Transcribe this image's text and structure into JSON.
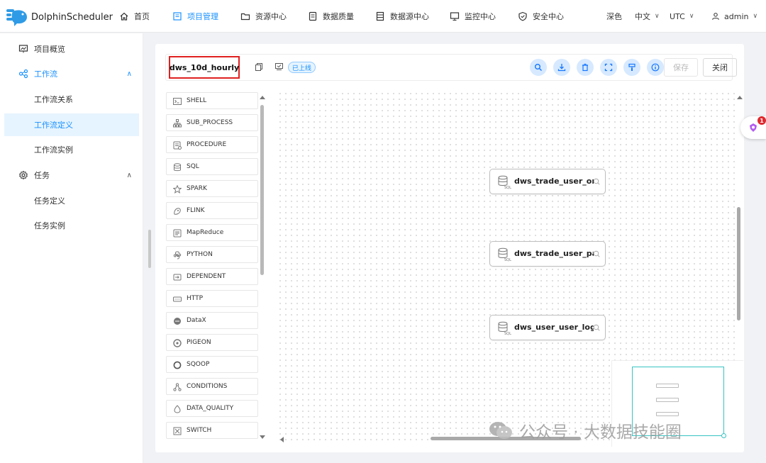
{
  "app": {
    "name": "DolphinScheduler",
    "colors": {
      "accent": "#1890ff",
      "highlight": "#e02020",
      "minimap": "#37c3c3"
    }
  },
  "nav": {
    "items": [
      {
        "label": "首页",
        "icon": "home-icon"
      },
      {
        "label": "项目管理",
        "icon": "project-icon",
        "active": true
      },
      {
        "label": "资源中心",
        "icon": "folder-icon"
      },
      {
        "label": "数据质量",
        "icon": "data-quality-icon"
      },
      {
        "label": "数据源中心",
        "icon": "datasource-icon"
      },
      {
        "label": "监控中心",
        "icon": "monitor-icon"
      },
      {
        "label": "安全中心",
        "icon": "shield-icon"
      }
    ],
    "theme": "深色",
    "language": "中文",
    "timezone": "UTC",
    "user": "admin"
  },
  "sidebar": {
    "overview": "项目概览",
    "workflow": "工作流",
    "workflow_items": [
      "工作流关系",
      "工作流定义",
      "工作流实例"
    ],
    "task": "任务",
    "task_items": [
      "任务定义",
      "任务实例"
    ]
  },
  "toolbar": {
    "workflow_name": "dws_10d_hourly",
    "status_badge": "已上线",
    "save_label": "保存",
    "close_label": "关闭",
    "buttons": [
      "search-icon",
      "download-icon",
      "delete-icon",
      "fullscreen-icon",
      "format-icon",
      "info-icon"
    ]
  },
  "palette": {
    "items": [
      {
        "label": "SHELL",
        "icon": "terminal-icon"
      },
      {
        "label": "SUB_PROCESS",
        "icon": "subprocess-icon"
      },
      {
        "label": "PROCEDURE",
        "icon": "procedure-icon"
      },
      {
        "label": "SQL",
        "icon": "database-icon"
      },
      {
        "label": "SPARK",
        "icon": "spark-icon"
      },
      {
        "label": "FLINK",
        "icon": "flink-icon"
      },
      {
        "label": "MapReduce",
        "icon": "mapreduce-icon"
      },
      {
        "label": "PYTHON",
        "icon": "python-icon"
      },
      {
        "label": "DEPENDENT",
        "icon": "dependent-icon"
      },
      {
        "label": "HTTP",
        "icon": "http-icon"
      },
      {
        "label": "DataX",
        "icon": "datax-icon"
      },
      {
        "label": "PIGEON",
        "icon": "pigeon-icon"
      },
      {
        "label": "SQOOP",
        "icon": "sqoop-icon"
      },
      {
        "label": "CONDITIONS",
        "icon": "conditions-icon"
      },
      {
        "label": "DATA_QUALITY",
        "icon": "data-quality-task-icon"
      },
      {
        "label": "SWITCH",
        "icon": "switch-icon"
      }
    ]
  },
  "canvas": {
    "nodes": [
      {
        "label": "dws_trade_user_ord",
        "type": "SQL"
      },
      {
        "label": "dws_trade_user_pay",
        "type": "SQL"
      },
      {
        "label": "dws_user_user_logi.",
        "type": "SQL"
      }
    ]
  },
  "floating": {
    "badge": "1"
  },
  "watermark": {
    "text": "公众号 · 大数据技能圈"
  }
}
